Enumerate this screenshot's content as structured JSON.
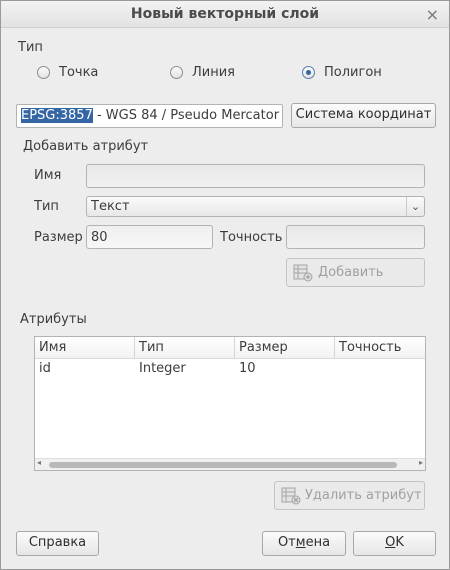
{
  "window": {
    "title": "Новый векторный слой"
  },
  "type_group": {
    "label": "Тип",
    "options": [
      {
        "label": "Точка",
        "checked": false
      },
      {
        "label": "Линия",
        "checked": false
      },
      {
        "label": "Полигон",
        "checked": true
      }
    ]
  },
  "crs": {
    "code": "EPSG:3857",
    "rest": " - WGS 84 / Pseudo Mercator",
    "button_label": "Система координат"
  },
  "add_attribute": {
    "label": "Добавить атрибут",
    "name_label": "Имя",
    "name_value": "",
    "type_label": "Тип",
    "type_value": "Текст",
    "size_label": "Размер",
    "size_value": "80",
    "precision_label": "Точность",
    "precision_value": "",
    "add_button_label": "Добавить"
  },
  "attributes": {
    "label": "Атрибуты",
    "columns": [
      "Имя",
      "Тип",
      "Размер",
      "Точность"
    ],
    "rows": [
      [
        "id",
        "Integer",
        "10",
        ""
      ]
    ],
    "delete_button_label": "Удалить атрибут"
  },
  "footer": {
    "help_label": "Справка",
    "cancel_label_prefix": "От",
    "cancel_label_mnemonic": "м",
    "cancel_label_suffix": "ена",
    "ok_label_mnemonic": "O",
    "ok_label_suffix": "K"
  }
}
